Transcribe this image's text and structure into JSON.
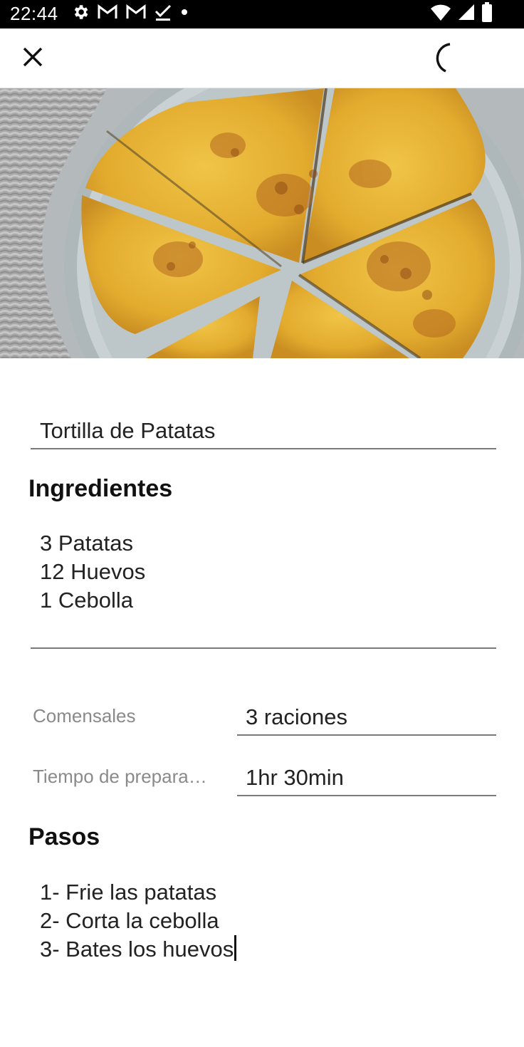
{
  "status_bar": {
    "time": "22:44",
    "left_icons": [
      "gear-icon",
      "gmail-icon",
      "gmail-icon",
      "done-check-icon",
      "dot-icon"
    ],
    "right_icons": [
      "wifi-icon",
      "signal-icon",
      "battery-icon"
    ]
  },
  "toolbar": {
    "close_icon": "close-icon",
    "loading_icon": "loading-spinner-icon"
  },
  "recipe": {
    "title": "Tortilla de Patatas",
    "ingredients_heading": "Ingredientes",
    "ingredients": [
      "3 Patatas",
      "12 Huevos",
      "1 Cebolla"
    ],
    "servings_label": "Comensales",
    "servings_value": "3 raciones",
    "prep_time_label": "Tiempo de prepara…",
    "prep_time_value": "1hr 30min",
    "steps_heading": "Pasos",
    "steps": [
      "1- Frie las patatas",
      "2- Corta la cebolla",
      "3- Bates los huevos"
    ]
  },
  "colors": {
    "status_bar": "#000000",
    "omelette": "#e8b63a",
    "plate": "#c7cfd2",
    "underline": "#7a7a7a",
    "label": "#8a8a8a"
  }
}
